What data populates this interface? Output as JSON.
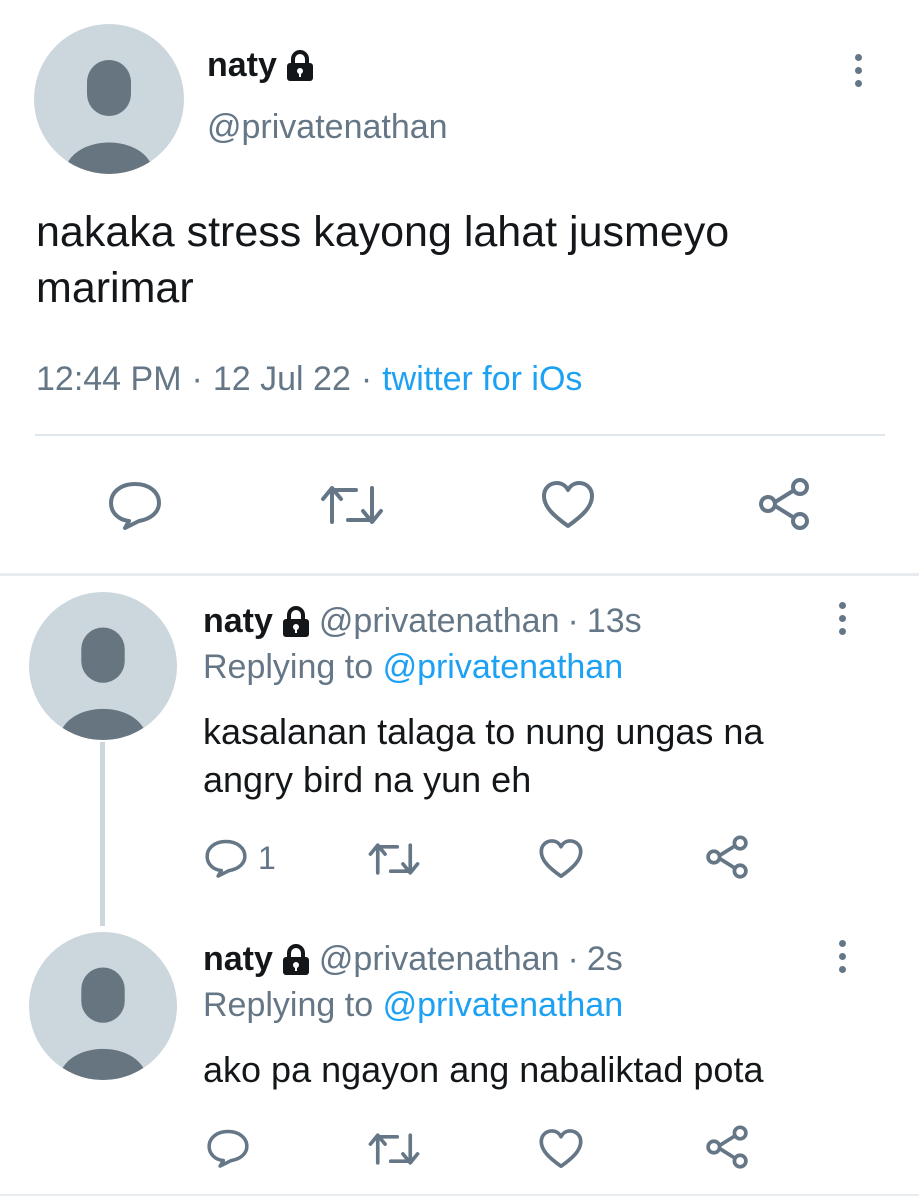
{
  "main_tweet": {
    "display_name": "naty",
    "handle": "@privatenathan",
    "text_line1": "nakaka stress kayong lahat jusmeyo",
    "text_line2": "marimar",
    "time": "12:44 PM",
    "date": "12 Jul 22",
    "separator": "·",
    "source": "twitter for iOs",
    "icons": [
      "lock-icon",
      "more-options-icon",
      "reply-icon",
      "retweet-icon",
      "like-icon",
      "share-icon"
    ]
  },
  "replies": [
    {
      "display_name": "naty",
      "handle": "@privatenathan",
      "separator": "·",
      "time_ago": "13s",
      "replying_label": "Replying to",
      "replying_handle": "@privatenathan",
      "text_line1": "kasalanan talaga to nung ungas na",
      "text_line2": "angry bird na yun eh",
      "reply_count": "1"
    },
    {
      "display_name": "naty",
      "handle": "@privatenathan",
      "separator": "·",
      "time_ago": "2s",
      "replying_label": "Replying to",
      "replying_handle": "@privatenathan",
      "text_line1": "ako pa ngayon ang nabaliktad pota",
      "reply_count": ""
    }
  ],
  "colors": {
    "accent": "#1da1f2",
    "muted_text": "#657786",
    "primary_text": "#14171a",
    "avatar_bg": "#ccd6dd",
    "avatar_figure": "#66757f",
    "divider": "#e1e8ed"
  }
}
